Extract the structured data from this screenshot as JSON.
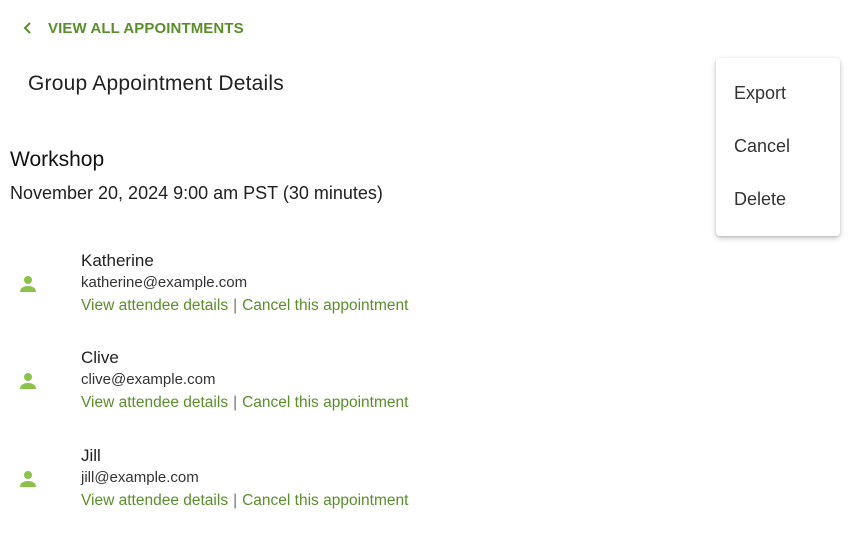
{
  "nav": {
    "back_label": "VIEW ALL APPOINTMENTS"
  },
  "header": {
    "title": "Group Appointment Details"
  },
  "event": {
    "title": "Workshop",
    "when": "November 20, 2024 9:00 am PST (30 minutes)"
  },
  "attendees": [
    {
      "name": "Katherine",
      "email": "katherine@example.com",
      "details_link": "View attendee details",
      "separator": "|",
      "cancel_link": "Cancel this appointment"
    },
    {
      "name": "Clive",
      "email": "clive@example.com",
      "details_link": "View attendee details",
      "separator": "|",
      "cancel_link": "Cancel this appointment"
    },
    {
      "name": "Jill",
      "email": "jill@example.com",
      "details_link": "View attendee details",
      "separator": "|",
      "cancel_link": "Cancel this appointment"
    }
  ],
  "menu": {
    "items": [
      "Export",
      "Cancel",
      "Delete"
    ]
  },
  "colors": {
    "accent": "#5a8e2a",
    "avatar": "#8bc34a"
  },
  "icons": {
    "back": "chevron-left-icon",
    "attendee": "person-icon"
  }
}
